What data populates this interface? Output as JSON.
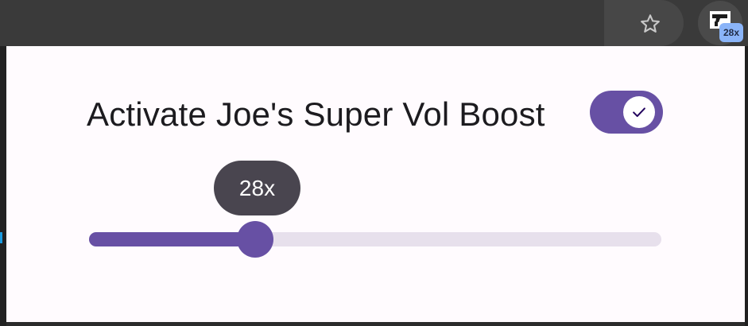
{
  "browser": {
    "bookmark_icon": "star-outline-icon",
    "extension": {
      "icon": "gun-icon",
      "badge": "28x"
    }
  },
  "popup": {
    "title": "Activate Joe's Super Vol Boost",
    "toggle": {
      "state": "on",
      "icon": "check-icon"
    },
    "slider": {
      "value_label": "28x",
      "fill_fraction": 0.29
    }
  },
  "colors": {
    "accent": "#6750a4",
    "track": "#e7e0ec",
    "tooltip": "#49454f",
    "badge": "#8ab4f8",
    "popup_bg": "#fffbfe",
    "toolbar": "#3a3a3a"
  }
}
